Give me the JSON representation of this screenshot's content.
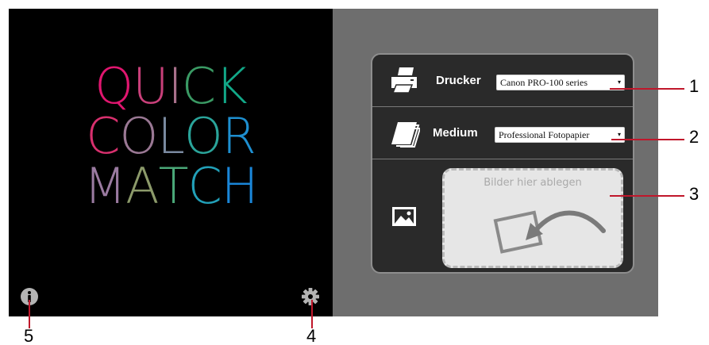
{
  "logo": {
    "lines": [
      {
        "letters": [
          {
            "ch": "Q",
            "color": "#e0166f"
          },
          {
            "ch": "U",
            "color": "#c9407a"
          },
          {
            "ch": "I",
            "color": "#a8708a"
          },
          {
            "ch": "C",
            "color": "#3a9a64"
          },
          {
            "ch": "K",
            "color": "#12a888"
          }
        ]
      },
      {
        "letters": [
          {
            "ch": "C",
            "color": "#d8306e"
          },
          {
            "ch": "O",
            "color": "#9a7894"
          },
          {
            "ch": "L",
            "color": "#7a8aa0"
          },
          {
            "ch": "O",
            "color": "#2aa49a"
          },
          {
            "ch": "R",
            "color": "#1e8fd0"
          }
        ]
      },
      {
        "letters": [
          {
            "ch": "M",
            "color": "#9a7aa0"
          },
          {
            "ch": "A",
            "color": "#8c9a6a"
          },
          {
            "ch": "T",
            "color": "#4aa878"
          },
          {
            "ch": "C",
            "color": "#22a0b8"
          },
          {
            "ch": "H",
            "color": "#1a86d8"
          }
        ]
      }
    ]
  },
  "panel": {
    "printer": {
      "icon": "printer-icon",
      "label": "Drucker",
      "selected": "Canon PRO-100 series",
      "arrow": "▾"
    },
    "media": {
      "icon": "paper-stack-icon",
      "label": "Medium",
      "selected": "Professional Fotopapier",
      "arrow": "▾"
    },
    "drop": {
      "icon": "image-icon",
      "text": "Bilder hier ablegen"
    }
  },
  "footer": {
    "info_icon": "info-icon",
    "settings_icon": "gear-icon"
  },
  "callouts": [
    "1",
    "2",
    "3",
    "4",
    "5"
  ],
  "colors": {
    "accent_callout": "#c0172b",
    "panel_bg": "#2a2a2a",
    "right_bg": "#6e6e6e"
  }
}
